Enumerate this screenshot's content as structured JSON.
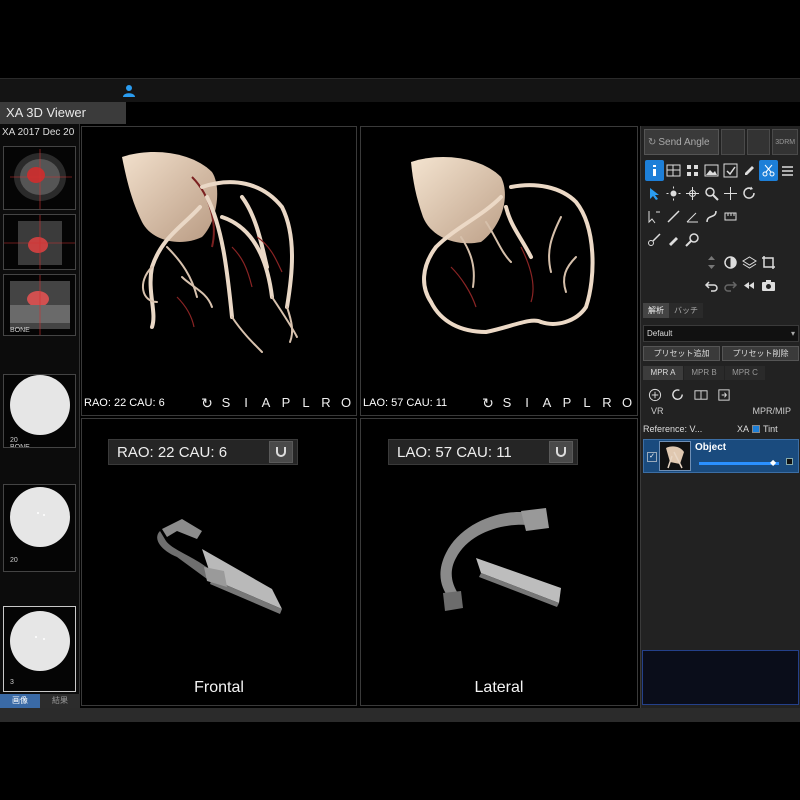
{
  "app": {
    "window_title": "XA 3D Viewer",
    "study_label": "XA 2017 Dec 20"
  },
  "series": [
    {
      "caption": ""
    },
    {
      "caption": ""
    },
    {
      "caption": "BONE"
    },
    {
      "caption": "20\nBONE"
    },
    {
      "caption": "20"
    },
    {
      "caption": "3"
    }
  ],
  "series_tabs": {
    "images": "画像",
    "results": "結果"
  },
  "viewports": {
    "frontal_3d": {
      "angle": "RAO: 22 CAU: 6"
    },
    "lateral_3d": {
      "angle": "LAO: 57 CAU: 11"
    },
    "orientation_letters": [
      "S",
      "I",
      "A",
      "P",
      "L",
      "R",
      "O"
    ],
    "frontal_arm": {
      "angle": "RAO:  22  CAU:  6",
      "caption": "Frontal"
    },
    "lateral_arm": {
      "angle": "LAO:  57  CAU:  11",
      "caption": "Lateral"
    }
  },
  "tools": {
    "send_angle": "Send Angle",
    "b_3drm": "3DRM",
    "func_tabs": {
      "analysis": "解析",
      "batch": "バッチ"
    },
    "preset_value": "Default",
    "preset_add": "プリセット追加",
    "preset_delete": "プリセット削除",
    "mpr_tabs": [
      "MPR A",
      "MPR B",
      "MPR C"
    ],
    "mode_vr": "VR",
    "mode_mpr": "MPR/MIP",
    "reference": "Reference: V...",
    "col_xa": "XA",
    "col_tint": "Tint",
    "object_label": "Object"
  },
  "colors": {
    "accent": "#1d7fd8",
    "selection": "#1a4b7e",
    "panel": "#222222"
  }
}
